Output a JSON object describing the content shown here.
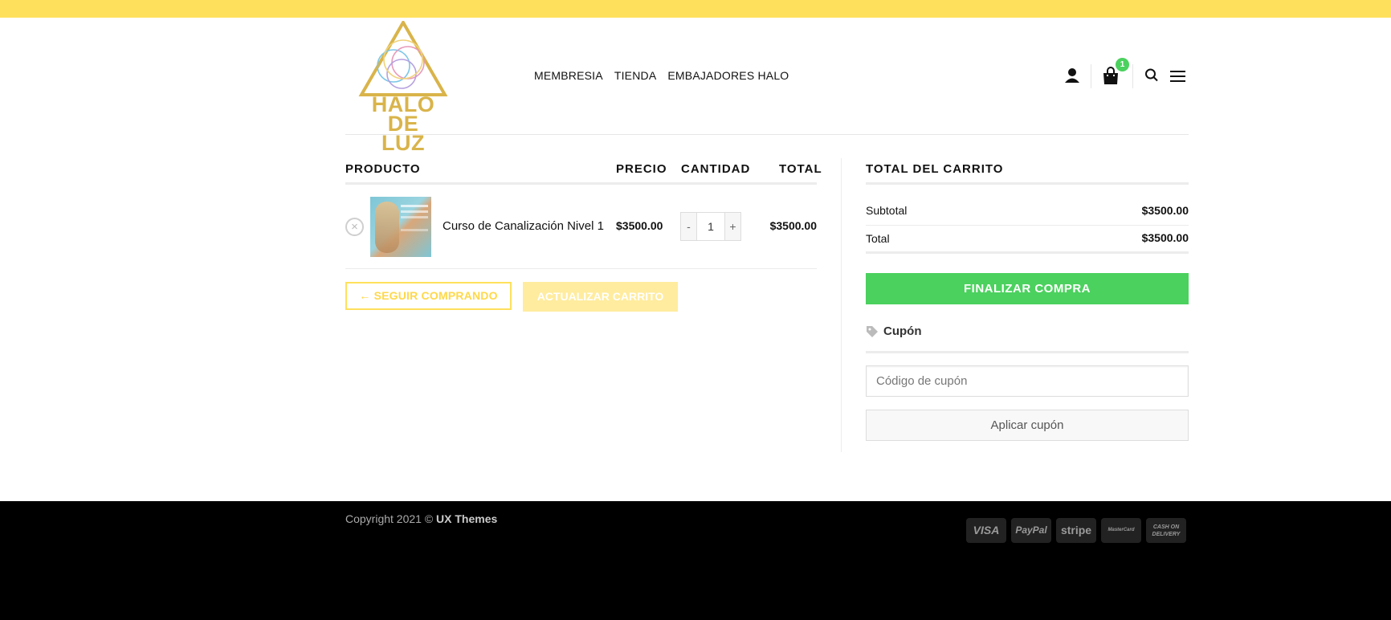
{
  "brand": {
    "logo_text_line1": "HALO DE",
    "logo_text_line2": "LUZ",
    "gold": "#d9b44a",
    "yellow": "#ffe05c",
    "green": "#4bd15e"
  },
  "nav": {
    "items": [
      "MEMBRESIA",
      "TIENDA",
      "EMBAJADORES HALO"
    ]
  },
  "header_icons": [
    "user-icon",
    "shopping-bag-icon",
    "search-icon",
    "menu-icon"
  ],
  "cart_badge": "1",
  "table": {
    "headers": {
      "product": "PRODUCTO",
      "price": "PRECIO",
      "quantity": "CANTIDAD",
      "total": "TOTAL"
    },
    "rows": [
      {
        "name": "Curso de Canalización Nivel 1",
        "price": "$3500.00",
        "quantity": "1",
        "total": "$3500.00"
      }
    ],
    "remove_symbol": "×",
    "minus": "-",
    "plus": "+"
  },
  "actions": {
    "continue": "← SEGUIR COMPRANDO",
    "update": "ACTUALIZAR CARRITO"
  },
  "totals": {
    "title": "TOTAL DEL CARRITO",
    "subtotal_label": "Subtotal",
    "subtotal_value": "$3500.00",
    "total_label": "Total",
    "total_value": "$3500.00",
    "checkout": "FINALIZAR COMPRA"
  },
  "coupon": {
    "heading": "Cupón",
    "placeholder": "Código de cupón",
    "apply": "Aplicar cupón"
  },
  "footer": {
    "copyright_prefix": "Copyright 2021 © ",
    "copyright_brand": "UX Themes",
    "payments": [
      "VISA",
      "PayPal",
      "stripe",
      "MasterCard",
      "CASH ON DELIVERY"
    ]
  }
}
